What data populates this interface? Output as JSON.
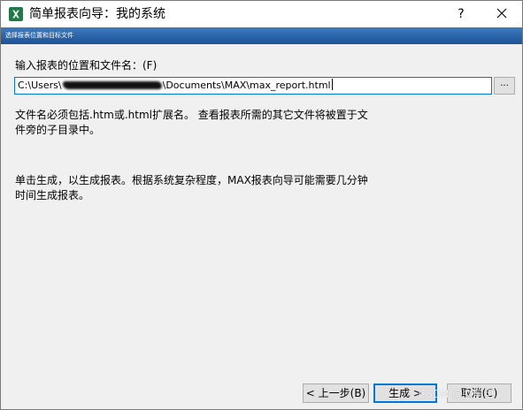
{
  "window": {
    "title": "简单报表向导：我的系统",
    "help_label": "?",
    "close_label": "✕"
  },
  "banner": {
    "text": "选择报表位置和目标文件"
  },
  "form": {
    "path_label": "输入报表的位置和文件名：(F)",
    "path_prefix": "C:\\Users\\",
    "path_suffix": "\\Documents\\MAX\\max_report.html",
    "browse_label": "..."
  },
  "text": {
    "para1": "文件名必须包括.htm或.html扩展名。 查看报表所需的其它文件将被置于文件旁的子目录中。",
    "para2": "单击生成，以生成报表。根据系统复杂程度，MAX报表向导可能需要几分钟时间生成报表。"
  },
  "buttons": {
    "back": "< 上一步(B)",
    "generate": "生成 >",
    "cancel": "取消(C)"
  },
  "watermark": "CSDN @女与可",
  "colors": {
    "banner_blue": "#2b64a8",
    "app_icon_green": "#1f7a45",
    "focus_blue": "#0078d7"
  },
  "icons": {
    "app": "excel-x-icon"
  }
}
